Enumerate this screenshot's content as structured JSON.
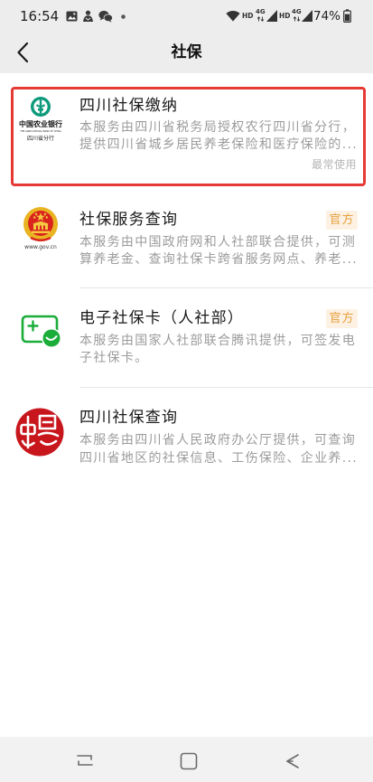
{
  "status_bar": {
    "time": "16:54",
    "notification_icons": [
      "gallery-icon",
      "app-notification-icon",
      "wechat-icon",
      "dot-icon"
    ],
    "sim1": {
      "hd": "HD",
      "network": "4G"
    },
    "sim2": {
      "hd": "HD",
      "network": "4G"
    },
    "battery_percent": "74%",
    "status_icons": [
      "wifi-icon",
      "signal-icon",
      "battery-icon"
    ]
  },
  "header": {
    "back_icon": "chevron-left-icon",
    "title": "社保"
  },
  "services": [
    {
      "title": "四川社保缴纳",
      "description": [
        "本服务由四川省税务局授权农行四川省分行，",
        "提供四川省城乡居民养老保险和医疗保险的..."
      ],
      "tag": "最常使用",
      "highlighted": true,
      "logo": {
        "icon": "abc-bank-logo",
        "name_cn": "中国农业银行",
        "name_en": "THE AGRICULTURAL BANK OF CHINA",
        "branch": "四川省分行"
      }
    },
    {
      "title": "社保服务查询",
      "badge": "官方",
      "description": [
        "本服务由中国政府网和人社部联合提供，可测",
        "算养老金、查询社保卡跨省服务网点、养老..."
      ],
      "logo": {
        "icon": "national-emblem-logo",
        "caption": "www.gov.cn"
      }
    },
    {
      "title": "电子社保卡（人社部）",
      "badge": "官方",
      "description": [
        "本服务由国家人社部联合腾讯提供，可签发电",
        "子社保卡。"
      ],
      "logo": {
        "icon": "social-security-card-logo"
      }
    },
    {
      "title": "四川社保查询",
      "description": [
        "本服务由四川省人民政府办公厅提供，可查询",
        "四川省地区的社保信息、工伤保险、企业养..."
      ],
      "logo": {
        "icon": "sichuan-seal-logo"
      }
    }
  ],
  "nav_bar": {
    "icons": [
      "recent-apps-icon",
      "home-icon",
      "back-icon"
    ]
  },
  "colors": {
    "highlight_border": "#e53a33",
    "badge_text": "#e8a040",
    "badge_background": "#fcf1e2",
    "title_text": "#191919",
    "description_text": "#9b9b9b",
    "header_background": "#ededed",
    "brand_green": "#1aad3a"
  }
}
